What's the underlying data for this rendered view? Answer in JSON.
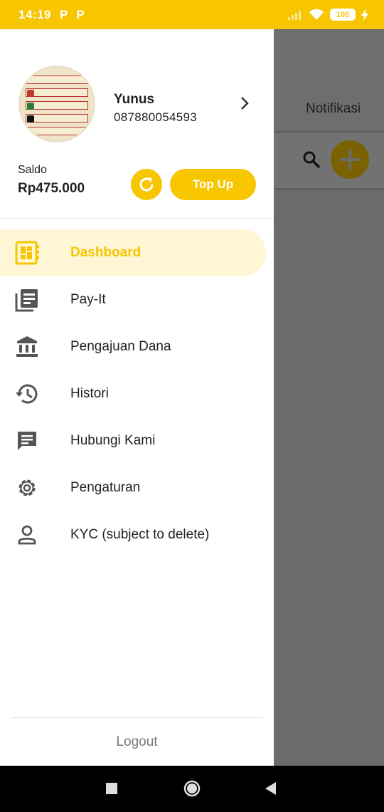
{
  "status_bar": {
    "time": "14:19",
    "notif_icons": [
      "P",
      "P"
    ],
    "battery": "100"
  },
  "background": {
    "header_title": "Notifikasi"
  },
  "drawer": {
    "user": {
      "name": "Yunus",
      "phone": "087880054593"
    },
    "saldo": {
      "label": "Saldo",
      "value": "Rp475.000"
    },
    "topup_label": "Top Up",
    "menu": [
      {
        "label": "Dashboard",
        "icon": "dashboard-icon",
        "active": true
      },
      {
        "label": "Pay-It",
        "icon": "receipt-icon",
        "active": false
      },
      {
        "label": "Pengajuan Dana",
        "icon": "bank-icon",
        "active": false
      },
      {
        "label": "Histori",
        "icon": "history-icon",
        "active": false
      },
      {
        "label": "Hubungi Kami",
        "icon": "chat-icon",
        "active": false
      },
      {
        "label": "Pengaturan",
        "icon": "gear-icon",
        "active": false
      },
      {
        "label": "KYC (subject to delete)",
        "icon": "person-icon",
        "active": false
      }
    ],
    "logout_label": "Logout"
  },
  "colors": {
    "accent": "#f7c600",
    "active_bg": "#fff6d6",
    "text": "#222222",
    "muted": "#777777"
  }
}
